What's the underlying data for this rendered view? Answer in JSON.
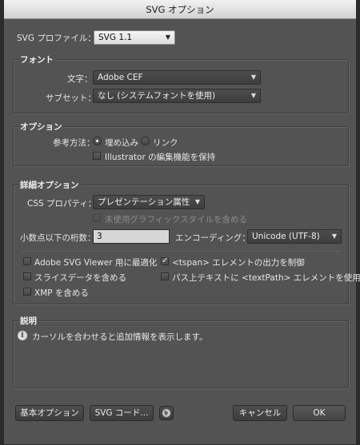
{
  "window": {
    "title": "SVG オプション"
  },
  "profile": {
    "label": "SVG プロファイル：",
    "value": "SVG 1.1"
  },
  "font": {
    "title": "フォント",
    "char_label": "文字：",
    "char_value": "Adobe CEF",
    "subset_label": "サブセット：",
    "subset_value": "なし (システムフォントを使用)"
  },
  "options": {
    "title": "オプション",
    "image_location_label": "参考方法：",
    "embed_label": "埋め込み",
    "link_label": "リンク",
    "preserve_label": "Illustrator の編集機能を保持"
  },
  "advanced": {
    "title": "詳細オプション",
    "css_label": "CSS プロパティ：",
    "css_value": "プレゼンテーション属性",
    "unused_styles_label": "未使用グラフィックスタイルを含める",
    "decimal_label": "小数点以下の桁数：",
    "decimal_value": "3",
    "encoding_label": "エンコーディング：",
    "encoding_value": "Unicode (UTF-8)",
    "viewer_label": "Adobe SVG Viewer 用に最適化",
    "tspan_label": "<tspan> エレメントの出力を制御",
    "slice_label": "スライスデータを含める",
    "textpath_label": "パス上テキストに <textPath> エレメントを使用",
    "xmp_label": "XMP を含める"
  },
  "description": {
    "title": "説明",
    "text": "カーソルを合わせると追加情報を表示します。"
  },
  "buttons": {
    "basic": "基本オプション",
    "svg_code": "SVG コード...",
    "cancel": "キャンセル",
    "ok": "OK"
  }
}
